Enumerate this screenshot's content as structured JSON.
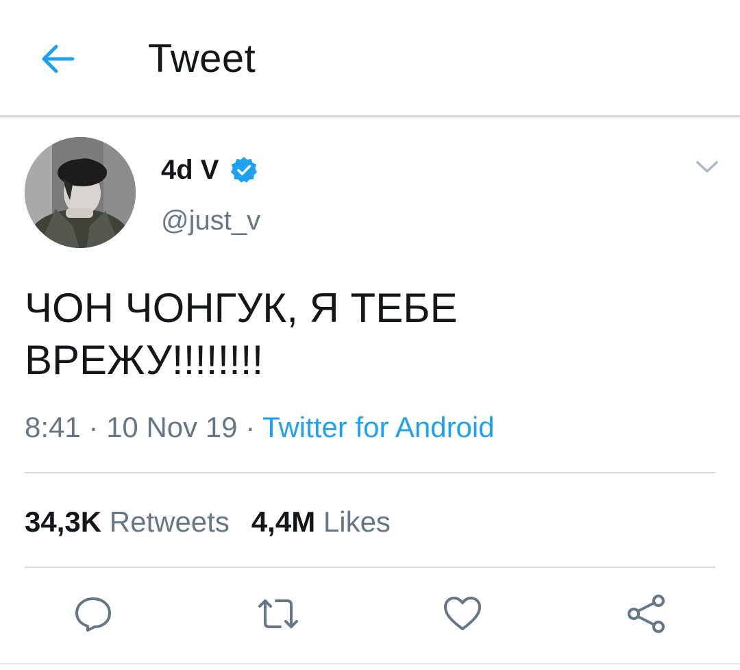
{
  "header": {
    "title": "Tweet",
    "back_icon": "arrow-left-icon",
    "accent_color": "#1da1f2"
  },
  "tweet": {
    "author": {
      "display_name": "4d V",
      "handle": "@just_v",
      "verified": true
    },
    "text_lines": [
      "ЧОН ЧОНГУК, Я ТЕБЕ",
      "ВРЕЖУ!!!!!!!!"
    ],
    "time": "8:41",
    "separator": " · ",
    "date": "10 Nov 19",
    "source": "Twitter for Android",
    "stats": {
      "retweets_count": "34,3K",
      "retweets_label": "Retweets",
      "likes_count": "4,4M",
      "likes_label": "Likes"
    },
    "actions": [
      "reply-icon",
      "retweet-icon",
      "like-icon",
      "share-icon"
    ]
  },
  "colors": {
    "text_primary": "#14171a",
    "text_secondary": "#657786",
    "link": "#1da1f2",
    "divider": "#d7dbde"
  }
}
